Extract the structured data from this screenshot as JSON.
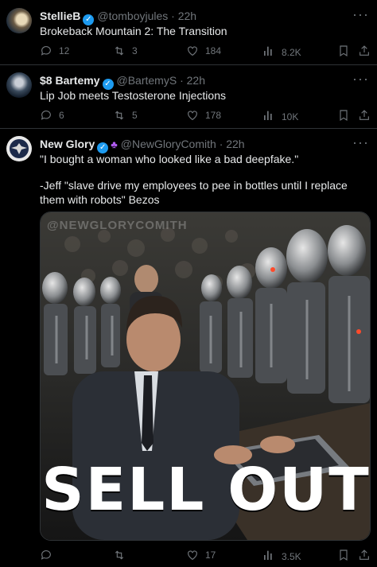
{
  "tweets": [
    {
      "name": "StellieB",
      "handle": "@tomboyjules",
      "time": "· 22h",
      "text": "Brokeback Mountain 2: The Transition",
      "replies": "12",
      "retweets": "3",
      "likes": "184",
      "views": "8.2K"
    },
    {
      "name": "$8 Bartemy",
      "handle": "@BartemyS",
      "time": "· 22h",
      "text": "Lip Job meets Testosterone Injections",
      "replies": "6",
      "retweets": "5",
      "likes": "178",
      "views": "10K"
    },
    {
      "name": "New Glory",
      "handle": "@NewGloryComith",
      "time": "· 22h",
      "text_line1": "\"I bought a woman who looked like a bad deepfake.\"",
      "text_line2": "-Jeff \"slave drive my employees to pee in bottles until I replace them with robots\" Bezos",
      "replies": "",
      "retweets": "",
      "likes": "17",
      "views": "3.5K",
      "image_caption": "SELL OUT",
      "image_watermark": "@NEWGLORYCOMITH"
    }
  ],
  "icons": {
    "reply": "reply-icon",
    "retweet": "retweet-icon",
    "like": "heart-icon",
    "views": "views-bar-icon",
    "bookmark": "bookmark-icon",
    "share": "share-icon",
    "more": "more-dots-icon",
    "verified": "verified-badge-icon"
  },
  "colors": {
    "background": "#000000",
    "text": "#e7e9ea",
    "muted": "#71767b",
    "verified": "#1d9bf0",
    "affiliate": "#b15cf2"
  }
}
